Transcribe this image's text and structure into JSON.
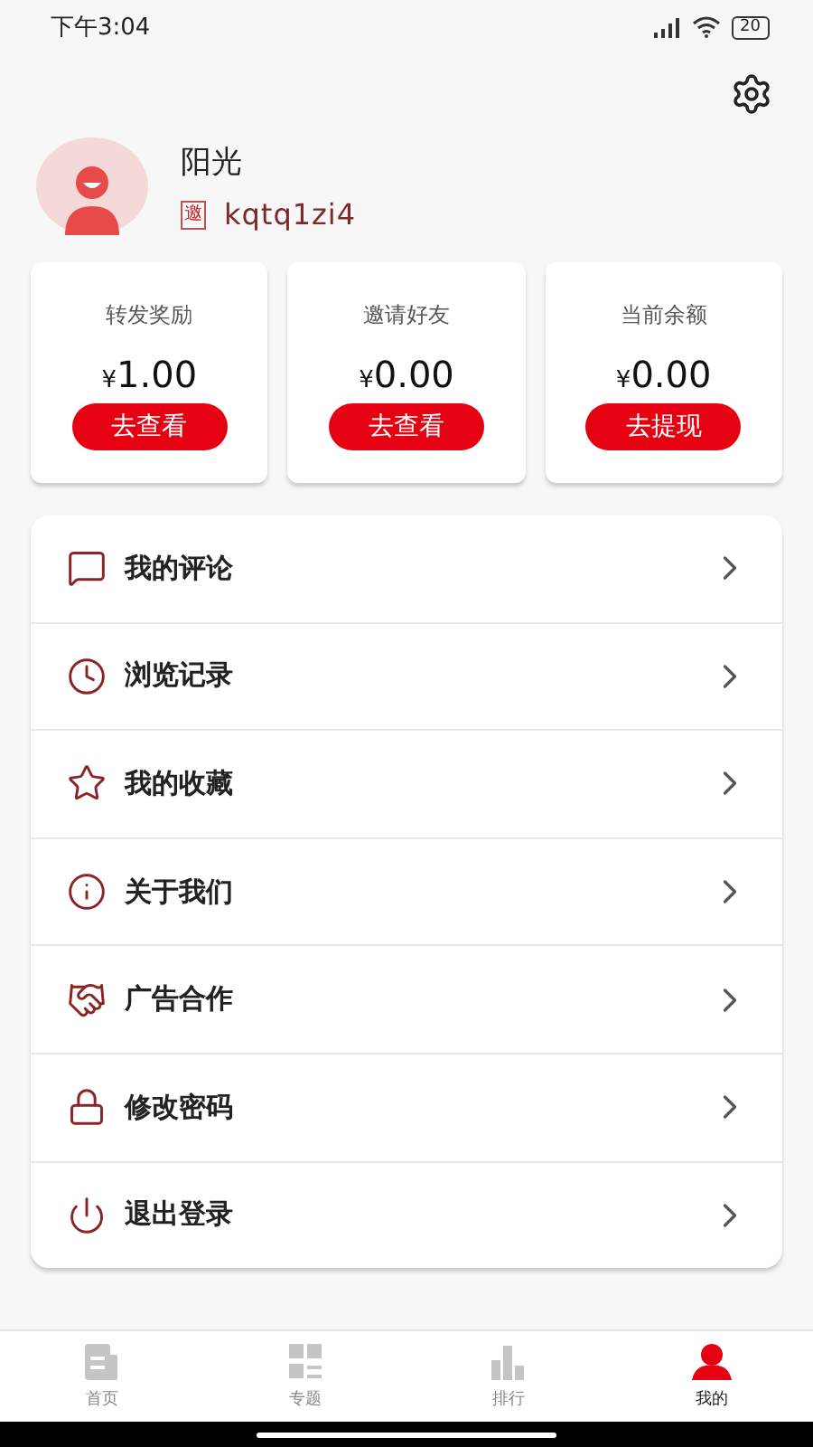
{
  "status_bar": {
    "time": "下午3:04",
    "battery": "20"
  },
  "profile": {
    "name": "阳光",
    "invite_badge": "邀",
    "invite_code": "kqtq1zi4"
  },
  "stats": [
    {
      "label": "转发奖励",
      "currency": "¥",
      "amount": "1.00",
      "button": "去查看"
    },
    {
      "label": "邀请好友",
      "currency": "¥",
      "amount": "0.00",
      "button": "去查看"
    },
    {
      "label": "当前余额",
      "currency": "¥",
      "amount": "0.00",
      "button": "去提现"
    }
  ],
  "menu": [
    {
      "kind": "comment",
      "label": "我的评论"
    },
    {
      "kind": "history",
      "label": "浏览记录"
    },
    {
      "kind": "favorite",
      "label": "我的收藏"
    },
    {
      "kind": "about",
      "label": "关于我们"
    },
    {
      "kind": "ads",
      "label": "广告合作"
    },
    {
      "kind": "password",
      "label": "修改密码"
    },
    {
      "kind": "logout",
      "label": "退出登录"
    }
  ],
  "tabs": [
    {
      "kind": "home",
      "label": "首页",
      "selected": false
    },
    {
      "kind": "topics",
      "label": "专题",
      "selected": false
    },
    {
      "kind": "ranking",
      "label": "排行",
      "selected": false
    },
    {
      "kind": "mine",
      "label": "我的",
      "selected": true
    }
  ]
}
